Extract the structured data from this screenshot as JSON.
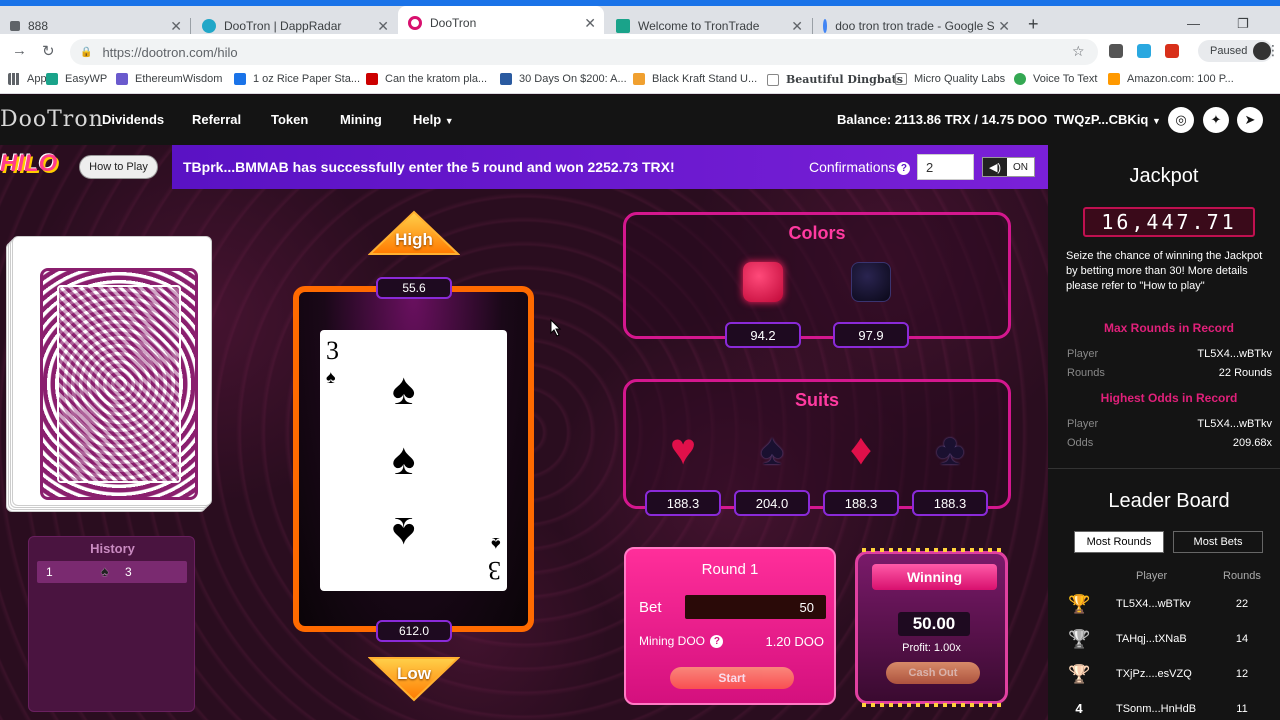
{
  "browser": {
    "tabs": [
      {
        "title": "888",
        "color": "#5f6368"
      },
      {
        "title": "DooTron | DappRadar",
        "color": "#21a7c8"
      },
      {
        "title": "DooTron",
        "color": "#d8106e"
      },
      {
        "title": "Welcome to TronTrade",
        "color": "#1aa38a"
      },
      {
        "title": "doo tron tron trade - Google Sea",
        "color": "#4285f4"
      }
    ],
    "url": "https://dootron.com/hilo",
    "profile": "Paused",
    "bookmarks": [
      {
        "label": "Apps",
        "color": "#5f6368"
      },
      {
        "label": "EasyWP",
        "color": "#1aa38a"
      },
      {
        "label": "EthereumWisdom",
        "color": "#6a5acd"
      },
      {
        "label": "1 oz Rice Paper Sta...",
        "color": "#1a73e8"
      },
      {
        "label": "Can the kratom pla...",
        "color": "#cc0000"
      },
      {
        "label": "30 Days On $200: A...",
        "color": "#2a5aa0"
      },
      {
        "label": "Black Kraft Stand U...",
        "color": "#f0a030"
      },
      {
        "label": "Beautiful Dingbats",
        "color": "#444444"
      },
      {
        "label": "Micro Quality Labs",
        "color": "#888888"
      },
      {
        "label": "Voice To Text",
        "color": "#34a853"
      },
      {
        "label": "Amazon.com: 100 P...",
        "color": "#ff9900"
      }
    ]
  },
  "nav": {
    "logo": "DooTron",
    "links": [
      "Dividends",
      "Referral",
      "Token",
      "Mining",
      "Help"
    ],
    "balance": "Balance: 2113.86 TRX / 14.75 DOO",
    "wallet": "TWQzP...CBKiq"
  },
  "game": {
    "logo": "HILO",
    "how_to_play": "How to Play",
    "banner_msg": "TBprk...BMMAB has successfully enter the 5 round and won 2252.73 TRX!",
    "confirmations_label": "Confirmations",
    "confirmations_value": "2",
    "sound": "ON",
    "high_label": "High",
    "low_label": "Low",
    "high_odds": "55.6",
    "low_odds": "612.0",
    "current_card": {
      "rank": "3",
      "suit": "♠"
    },
    "history": {
      "title": "History",
      "rows": [
        {
          "num": "1",
          "suit": "♠",
          "value": "3"
        }
      ]
    },
    "colors": {
      "title": "Colors",
      "items": [
        {
          "color": "#e0104a",
          "odds": "94.2"
        },
        {
          "color": "#141028",
          "odds": "97.9"
        }
      ]
    },
    "suits": {
      "title": "Suits",
      "items": [
        {
          "symbol": "♥",
          "color": "#e0104a",
          "odds": "188.3"
        },
        {
          "symbol": "♠",
          "color": "#1a1030",
          "odds": "204.0"
        },
        {
          "symbol": "♦",
          "color": "#e0104a",
          "odds": "188.3"
        },
        {
          "symbol": "♣",
          "color": "#1a1030",
          "odds": "188.3"
        }
      ]
    },
    "round": {
      "title": "Round 1",
      "bet_label": "Bet",
      "bet_value": "50",
      "mining_label": "Mining DOO",
      "mining_value": "1.20 DOO",
      "start": "Start"
    },
    "winning": {
      "title": "Winning",
      "amount": "50.00",
      "profit": "Profit: 1.00x",
      "cashout": "Cash Out"
    }
  },
  "sidebar": {
    "jackpot_title": "Jackpot",
    "jackpot_value": "16,447.71",
    "jackpot_desc": "Seize the chance of winning the Jackpot by betting more than 30! More details please refer to \"How to play\"",
    "max_rounds": {
      "title": "Max Rounds in Record",
      "player_label": "Player",
      "player": "TL5X4...wBTkv",
      "rounds_label": "Rounds",
      "rounds": "22 Rounds"
    },
    "highest_odds": {
      "title": "Highest Odds in Record",
      "player_label": "Player",
      "player": "TL5X4...wBTkv",
      "odds_label": "Odds",
      "odds": "209.68x"
    },
    "leaderboard": {
      "title": "Leader Board",
      "tabs": [
        "Most Rounds",
        "Most Bets"
      ],
      "col_player": "Player",
      "col_rounds": "Rounds",
      "rows": [
        {
          "rank": "🏆",
          "player": "TL5X4...wBTkv",
          "rounds": "22",
          "color": "#e0b020"
        },
        {
          "rank": "🏆",
          "player": "TAHqj...tXNaB",
          "rounds": "14",
          "color": "#b0b0b0"
        },
        {
          "rank": "🏆",
          "player": "TXjPz....esVZQ",
          "rounds": "12",
          "color": "#d07040"
        },
        {
          "rank": "4",
          "player": "TSonm...HnHdB",
          "rounds": "11",
          "color": "#ffffff"
        }
      ]
    }
  }
}
